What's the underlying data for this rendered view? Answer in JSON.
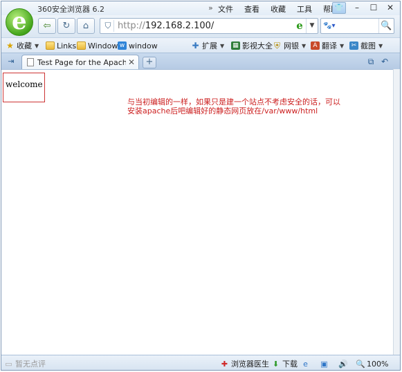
{
  "window": {
    "title": "360安全浏览器 6.2",
    "menu": [
      "文件",
      "查看",
      "收藏",
      "工具",
      "帮助"
    ]
  },
  "nav": {
    "url_scheme": "http://",
    "url_host": "192.168.2.100/"
  },
  "bookmarks": [
    {
      "label": "收藏",
      "icon": "star-icon",
      "dropdown": true
    },
    {
      "label": "Links",
      "icon": "folder-icon",
      "dropdown": false
    },
    {
      "label": "Window",
      "icon": "folder-icon",
      "dropdown": false
    },
    {
      "label": "window",
      "icon": "window-icon",
      "dropdown": false
    },
    {
      "label": "扩展",
      "icon": "puzzle-icon",
      "dropdown": true
    },
    {
      "label": "影视大全",
      "icon": "film-icon",
      "dropdown": false
    },
    {
      "label": "网银",
      "icon": "bank-icon",
      "dropdown": true
    },
    {
      "label": "翻译",
      "icon": "translate-icon",
      "dropdown": true
    },
    {
      "label": "截图",
      "icon": "scissors-icon",
      "dropdown": true
    }
  ],
  "tab": {
    "title": "Test Page for the Apache H"
  },
  "page": {
    "welcome": "welcome",
    "note_line1": "与当初编辑的一样，如果只是建一个站点不考虑安全的话，可以",
    "note_line2": "安装apache后吧编辑好的静态网页放在/var/www/html"
  },
  "status": {
    "comment": "暂无点评",
    "doctor": "浏览器医生",
    "download": "下载",
    "zoom": "100%"
  },
  "colors": {
    "note_text": "#cc1f1f",
    "welcome_border": "#cc3333",
    "chrome": "#dbe7f4"
  }
}
